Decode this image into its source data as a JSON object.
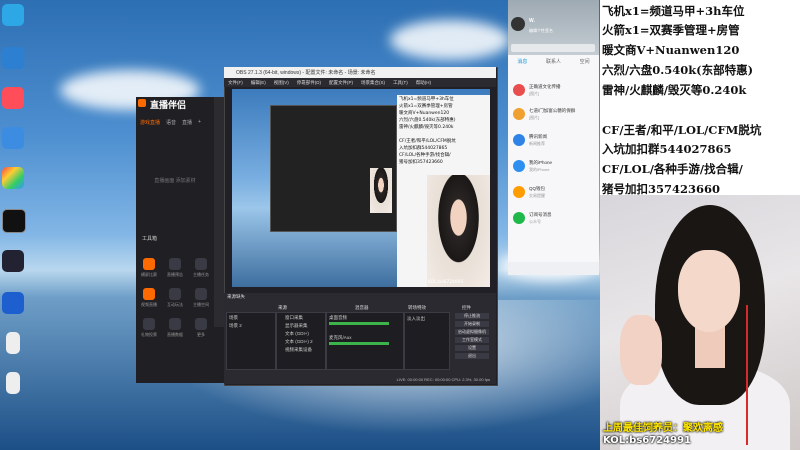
{
  "colors": {
    "accent": "#ff6a00",
    "qq_blue": "#1296db",
    "banner_yellow": "#ffe600"
  },
  "desktop": {
    "icons": [
      "edge-icon",
      "music-icon",
      "app-icon",
      "palette-icon",
      "capcut-icon",
      "game-icon",
      "chat-icon",
      "doc-icon",
      "file-icon"
    ]
  },
  "companion_app": {
    "title": "直播伴侣",
    "tabs": [
      "游戏直播",
      "语音",
      "直播",
      "+"
    ],
    "empty_text": "直播画面\n添加素材",
    "tools_label": "工具箱",
    "tools": [
      "横屏比赛",
      "直播预告",
      "主播任务",
      "视频直播",
      "互动玩法",
      "主播空间",
      "礼物投票",
      "直播数据",
      "更多"
    ]
  },
  "obs": {
    "title": "OBS 27.1.3 (64-bit, windows) - 配置文件: 未命名 - 场景: 未命名",
    "menu": [
      "文件(F)",
      "编辑(E)",
      "视图(V)",
      "停靠部件(D)",
      "配置文件(P)",
      "场景集合(S)",
      "工具(T)",
      "帮助(H)"
    ],
    "preview_text": [
      "飞机x1=频道马甲+3h车位",
      "火箭x1=双赛季管理+房管",
      "暖文商V+Nuanwen120",
      "六烈/六盘0.540k(东部特惠)",
      "雷神/火麒麟/毁灭等0.240k",
      "CF/王者/和平/LOL/CFM脱坑",
      "入坑加扣群544027865",
      "CF/LOL/各种手游/找合辑/",
      "猪号加扣357423660"
    ],
    "preview_caption": "KOL:bs6724991",
    "docks": {
      "scenes_title": "来源缺失",
      "scenes": [
        "场景",
        "场景 2"
      ],
      "sources_title": "来源",
      "sources": [
        "窗口采集",
        "显示器采集",
        "文本 (GDI+)",
        "文本 (GDI+) 2",
        "视频采集设备"
      ],
      "mixer_title": "混音器",
      "mixer": [
        "桌面音频",
        "麦克风/Aux"
      ],
      "transitions_title": "转场特效",
      "transition_value": "淡入淡出",
      "controls_title": "控件",
      "controls": [
        "停止推流",
        "开始录制",
        "启动虚拟摄像机",
        "工作室模式",
        "设置",
        "退出"
      ]
    },
    "status": "LIVE: 00:00:00  REC: 00:00:00  CPU: 2.3%, 30.00 fps"
  },
  "qq": {
    "name": "W.",
    "status": "编辑个性签名",
    "tabs": [
      "消息",
      "联系人",
      "空间"
    ],
    "items": [
      {
        "name": "正确道文化传播",
        "msg": "[图片]",
        "color": "#e94d4d"
      },
      {
        "name": "七道/门加富公糖的保群",
        "msg": "[图片]",
        "color": "#f0a030"
      },
      {
        "name": "腾讯新闻",
        "msg": "新闻推荐",
        "color": "#2f83e6"
      },
      {
        "name": "我的iPhone",
        "msg": "我的iPhone",
        "color": "#2d90f0"
      },
      {
        "name": "QQ钱包",
        "msg": "交易提醒",
        "color": "#ff9c00"
      },
      {
        "name": "订阅号消息",
        "msg": "公众号",
        "color": "#1fb84a"
      }
    ]
  },
  "overlay": {
    "lines": [
      "飞机x1=频道马甲+3h车位",
      "火箭x1=双赛季管理+房管",
      "暖文商V+Nuanwen120",
      "六烈/六盘0.540k(东部特惠)",
      "雷神/火麒麟/毁灭等0.240k",
      "",
      "CF/王者/和平/LOL/CFM脱坑",
      "入坑加扣群544027865",
      "CF/LOL/各种手游/找合辑/",
      "猪号加扣357423660"
    ],
    "best_fan_label": "上周最佳饲养员：聚欢离感",
    "kol": "KOL:bs6724991"
  }
}
